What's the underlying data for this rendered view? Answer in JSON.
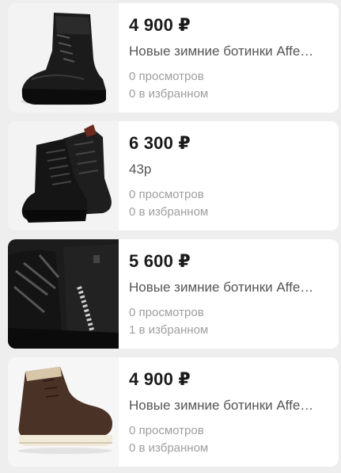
{
  "listings": [
    {
      "price": "4 900 ₽",
      "title": "Новые зимние ботинки Affe…",
      "views": "0 просмотров",
      "favorites": "0 в избранном",
      "image": "black-boot-side-icon"
    },
    {
      "price": "6 300 ₽",
      "title": "43р",
      "views": "0 просмотров",
      "favorites": "0 в избранном",
      "image": "black-boots-pair-icon"
    },
    {
      "price": "5 600 ₽",
      "title": "Новые зимние ботинки Affe…",
      "views": "0 просмотров",
      "favorites": "1 в избранном",
      "image": "black-boots-closeup-icon"
    },
    {
      "price": "4 900 ₽",
      "title": "Новые зимние ботинки Affe…",
      "views": "0 просмотров",
      "favorites": "0 в избранном",
      "image": "brown-chukka-boot-icon"
    }
  ]
}
